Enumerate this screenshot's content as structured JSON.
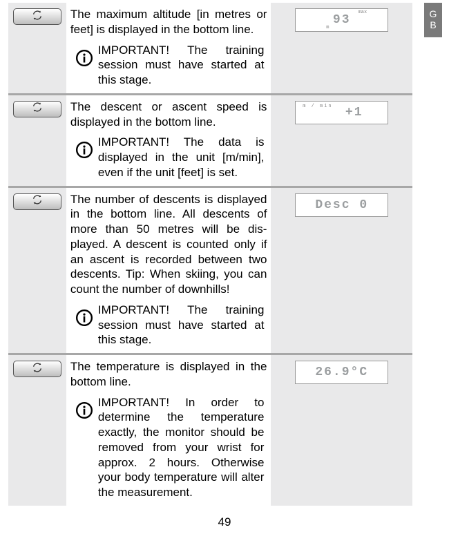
{
  "language_tab": "G\nB",
  "page_number": "49",
  "rows": [
    {
      "description": "The maximum altitude [in metres or feet] is displayed in the bottom line.",
      "note": "IMPORTANT! The training session must have started at this stage.",
      "display_value": "93",
      "display_label_top": "max",
      "display_label_bottom": "m"
    },
    {
      "description": "The descent or ascent speed is displayed in the bottom line.",
      "note": "IMPORTANT! The data is displayed in the unit [m/min], even if the unit [feet] is set.",
      "display_value": "+1",
      "display_label_mmin": "m / min"
    },
    {
      "description": "The number of descents is displayed in the bottom line. All descents of more than 50 metres will be dis­played. A descent is counted only if an ascent is recorded between two descents. Tip: When skiing, you can count the number of downhills!",
      "note": "IMPORTANT! The training session must have started at this stage.",
      "display_value": "Desc  0"
    },
    {
      "description": "The temperature is displayed in the bottom line.",
      "note": "IMPORTANT! In order to determine the temperature exactly, the monitor should be removed from your wrist for approx. 2 hours. Other­wise your body temperature will alter the measurement.",
      "display_value": "26.9°C"
    }
  ]
}
